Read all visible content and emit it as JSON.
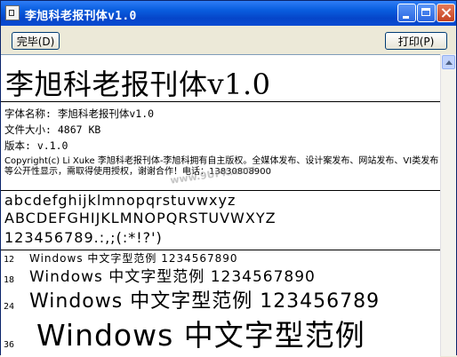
{
  "window": {
    "title": "李旭科老报刊体v1.0",
    "icon": "font-file-icon"
  },
  "toolbar": {
    "done_label": "完毕(D)",
    "print_label": "打印(P)"
  },
  "preview": {
    "font_title": "李旭科老报刊体v1.0",
    "info": {
      "font_name": "字体名称: 李旭科老报刊体v1.0",
      "file_size": "文件大小: 4867 KB",
      "version": "版本: v.1.0"
    },
    "copyright": "Copyright(c) Li Xuke 李旭科老报刊体-李旭科拥有自主版权。全媒体发布、设计案发布、网站发布、VI类发布等公开性显示，需取得使用授权，谢谢合作！电话：13830808900",
    "watermark": "www.9UPK.com",
    "samples": {
      "lowercase": "abcdefghijklmnopqrstuvwxyz",
      "uppercase": "ABCDEFGHIJKLMNOPQRSTUVWXYZ",
      "digits": "123456789.:,;(:*!?')"
    },
    "size_rows": [
      {
        "size": "12",
        "text": "Windows 中文字型范例 1234567890"
      },
      {
        "size": "18",
        "text": "Windows 中文字型范例 1234567890"
      },
      {
        "size": "24",
        "text": "Windows 中文字型范例 123456789"
      },
      {
        "size": "36",
        "text": "Windows 中文字型范例"
      }
    ]
  }
}
